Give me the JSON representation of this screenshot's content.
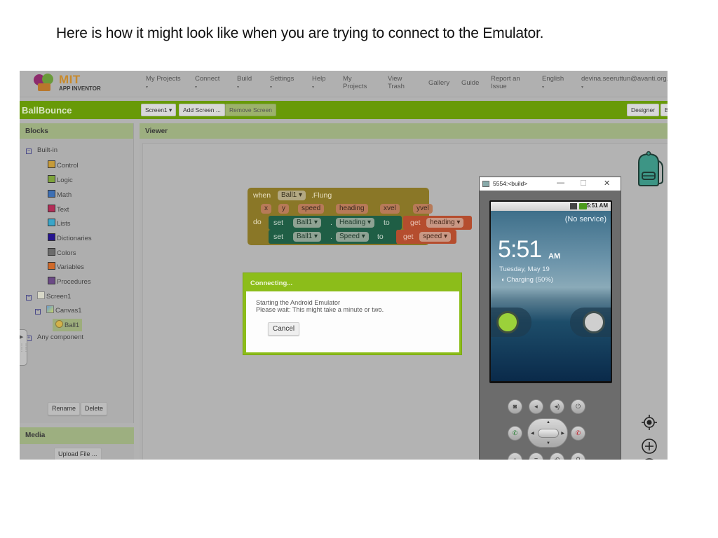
{
  "caption": "Here is how it might look like when you are trying to connect to the Emulator.",
  "logo": {
    "mit": "MIT",
    "app_inventor": "APP INVENTOR"
  },
  "nav": [
    {
      "label": "My Projects",
      "caret": "▾"
    },
    {
      "label": "Connect",
      "caret": "▾"
    },
    {
      "label": "Build",
      "caret": "▾"
    },
    {
      "label": "Settings",
      "caret": "▾"
    },
    {
      "label": "Help",
      "caret": "▾"
    },
    {
      "label": "My\nProjects"
    },
    {
      "label": "View\nTrash"
    },
    {
      "label": "Gallery"
    },
    {
      "label": "Guide"
    },
    {
      "label": "Report an\nIssue"
    },
    {
      "label": "English",
      "caret": "▾"
    },
    {
      "label": "devina.seeruttun@avanti.org.uk",
      "caret": "▾"
    }
  ],
  "project": {
    "title": "BallBounce",
    "screen_select": "Screen1 ▾",
    "add_screen": "Add Screen ...",
    "remove_screen": "Remove Screen",
    "designer": "Designer",
    "blocks": "Blocks"
  },
  "blocks_panel": {
    "title": "Blocks",
    "builtin": "Built-in",
    "categories": [
      {
        "label": "Control",
        "color": "#c69b3a"
      },
      {
        "label": "Logic",
        "color": "#7ea33c"
      },
      {
        "label": "Math",
        "color": "#3d6fb4"
      },
      {
        "label": "Text",
        "color": "#b32d57"
      },
      {
        "label": "Lists",
        "color": "#3aa6c9"
      },
      {
        "label": "Dictionaries",
        "color": "#26158f"
      },
      {
        "label": "Colors",
        "color": "#6b6b6b"
      },
      {
        "label": "Variables",
        "color": "#d06a2a"
      },
      {
        "label": "Procedures",
        "color": "#6b4a86"
      }
    ],
    "screen": "Screen1",
    "canvas": "Canvas1",
    "ball": "Ball1",
    "any_component": "Any component",
    "rename": "Rename",
    "delete": "Delete"
  },
  "media": {
    "title": "Media",
    "upload": "Upload File ..."
  },
  "viewer": {
    "title": "Viewer"
  },
  "code": {
    "when": "when",
    "component": "Ball1 ▾",
    "event": ".Flung",
    "params": [
      "x",
      "y",
      "speed",
      "heading",
      "xvel",
      "yvel"
    ],
    "do": "do",
    "set1": {
      "set": "set",
      "comp": "Ball1 ▾",
      "dot": ".",
      "prop": "Heading ▾",
      "to": "to",
      "get": "get",
      "var": "heading ▾"
    },
    "set2": {
      "set": "set",
      "comp": "Ball1 ▾",
      "dot": ".",
      "prop": "Speed ▾",
      "to": "to",
      "get": "get",
      "var": "speed ▾"
    }
  },
  "dialog": {
    "title": "Connecting...",
    "line1": "Starting the Android Emulator",
    "line2": "Please wait: This might take a minute or two.",
    "cancel": "Cancel"
  },
  "emulator": {
    "window_title": "5554:<build>",
    "minimize": "—",
    "maximize": "☐",
    "close": "✕",
    "status_time": "5:51 AM",
    "no_service": "(No service)",
    "time": "5:51",
    "ampm": "AM",
    "date": "Tuesday, May 19",
    "charging": "Charging (50%)"
  }
}
